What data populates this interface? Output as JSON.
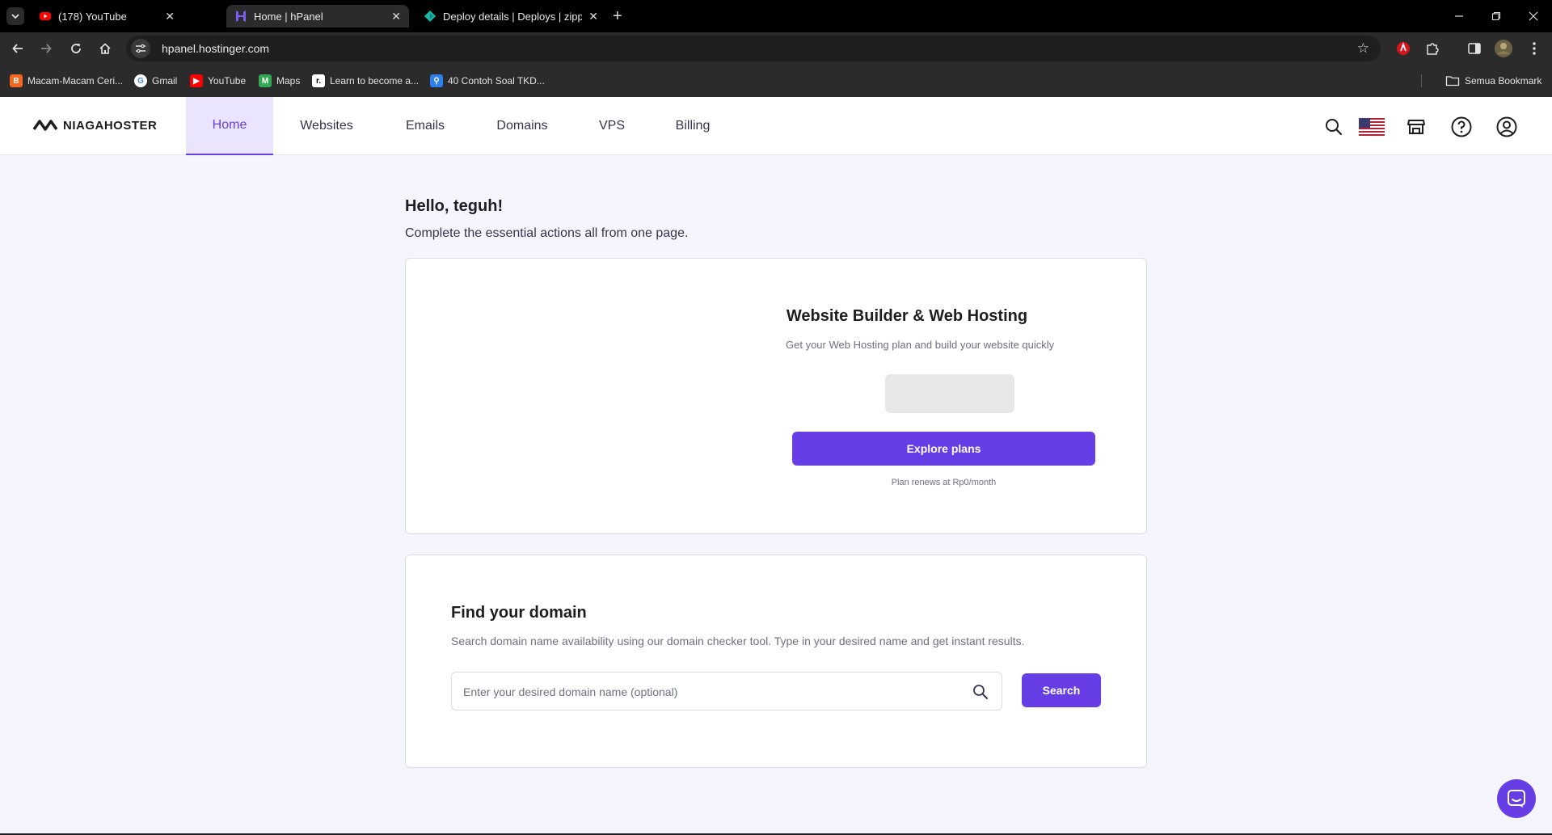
{
  "browser": {
    "tabs": [
      {
        "title": "(178) YouTube",
        "active": false
      },
      {
        "title": "Home | hPanel",
        "active": true
      },
      {
        "title": "Deploy details | Deploys | zippy",
        "active": false
      }
    ],
    "url": "hpanel.hostinger.com",
    "bookmarks": [
      "Macam-Macam Ceri...",
      "Gmail",
      "YouTube",
      "Maps",
      "Learn to become a...",
      "40 Contoh Soal TKD..."
    ],
    "bookmarks_folder": "Semua Bookmark"
  },
  "header": {
    "logo": "NIAGAHOSTER",
    "nav": [
      {
        "label": "Home",
        "active": true
      },
      {
        "label": "Websites",
        "active": false
      },
      {
        "label": "Emails",
        "active": false
      },
      {
        "label": "Domains",
        "active": false
      },
      {
        "label": "VPS",
        "active": false
      },
      {
        "label": "Billing",
        "active": false
      }
    ]
  },
  "main": {
    "greeting": "Hello, teguh!",
    "subtitle": "Complete the essential actions all from one page."
  },
  "hosting_card": {
    "title": "Website Builder & Web Hosting",
    "description": "Get your Web Hosting plan and build your website quickly",
    "button_label": "Explore plans",
    "note": "Plan renews at Rp0/month"
  },
  "domain_card": {
    "title": "Find your domain",
    "description": "Search domain name availability using our domain checker tool. Type in your desired name and get instant results.",
    "input_placeholder": "Enter your desired domain name (optional)",
    "input_value": "",
    "button_label": "Search"
  },
  "colors": {
    "primary": "#673de6",
    "nav_active_bg": "#ebe4ff",
    "page_bg": "#f4f5ff"
  }
}
